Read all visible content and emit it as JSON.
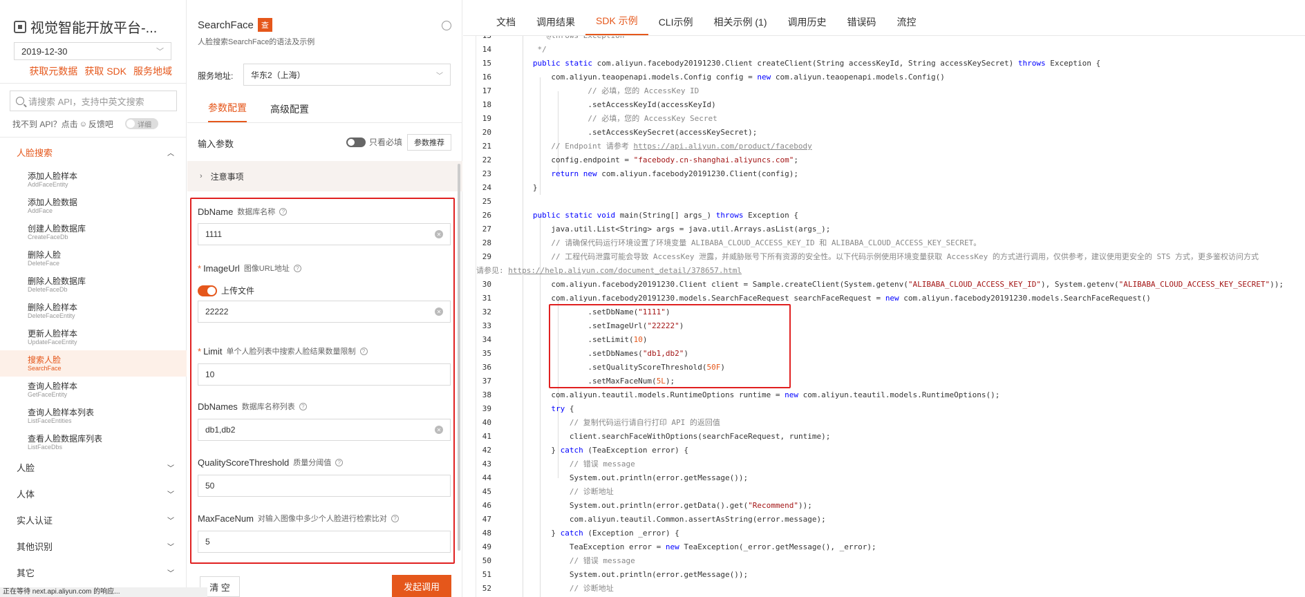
{
  "sidebar": {
    "brand": "视觉智能开放平台-...",
    "version": "2019-12-30",
    "links": [
      "获取元数据",
      "获取 SDK",
      "服务地域"
    ],
    "search_placeholder": "请搜索 API，支持中英文搜索",
    "feedback_text": "找不到 API？点击",
    "feedback_link": "反馈吧",
    "detail_toggle": "详细",
    "groups": {
      "face_search": "人脸搜索",
      "face": "人脸",
      "body": "人体",
      "realname": "实人认证",
      "other_recog": "其他识别",
      "other": "其它"
    },
    "items": [
      {
        "cn": "添加人脸样本",
        "en": "AddFaceEntity"
      },
      {
        "cn": "添加人脸数据",
        "en": "AddFace"
      },
      {
        "cn": "创建人脸数据库",
        "en": "CreateFaceDb"
      },
      {
        "cn": "删除人脸",
        "en": "DeleteFace"
      },
      {
        "cn": "删除人脸数据库",
        "en": "DeleteFaceDb"
      },
      {
        "cn": "删除人脸样本",
        "en": "DeleteFaceEntity"
      },
      {
        "cn": "更新人脸样本",
        "en": "UpdateFaceEntity"
      },
      {
        "cn": "搜索人脸",
        "en": "SearchFace"
      },
      {
        "cn": "查询人脸样本",
        "en": "GetFaceEntity"
      },
      {
        "cn": "查询人脸样本列表",
        "en": "ListFaceEntities"
      },
      {
        "cn": "查看人脸数据库列表",
        "en": "ListFaceDbs"
      }
    ],
    "status": "正在等待 next.api.aliyun.com 的响应..."
  },
  "middle": {
    "api_name": "SearchFace",
    "badge": "查",
    "subtitle": "人脸搜索SearchFace的语法及示例",
    "endpoint_label": "服务地址:",
    "endpoint_value": "华东2（上海）",
    "tabs": [
      "参数配置",
      "高级配置"
    ],
    "input_params": "输入参数",
    "required_only": "只看必填",
    "recommend": "参数推荐",
    "notice": "注意事项",
    "params": {
      "dbname": {
        "name": "DbName",
        "desc": "数据库名称",
        "value": "1111"
      },
      "imageurl": {
        "name": "ImageUrl",
        "desc": "图像URL地址",
        "upload": "上传文件",
        "value": "22222"
      },
      "limit": {
        "name": "Limit",
        "desc": "单个人脸列表中搜索人脸结果数量限制",
        "value": "10"
      },
      "dbnames": {
        "name": "DbNames",
        "desc": "数据库名称列表",
        "value": "db1,db2"
      },
      "quality": {
        "name": "QualityScoreThreshold",
        "desc": "质量分阈值",
        "value": "50"
      },
      "maxface": {
        "name": "MaxFaceNum",
        "desc": "对输入图像中多少个人脸进行检索比对",
        "value": "5"
      }
    },
    "clear": "清 空",
    "invoke": "发起调用"
  },
  "right": {
    "tabs": [
      "文档",
      "调用结果",
      "SDK 示例",
      "CLI示例",
      "相关示例 (1)",
      "调用历史",
      "错误码",
      "流控"
    ]
  }
}
